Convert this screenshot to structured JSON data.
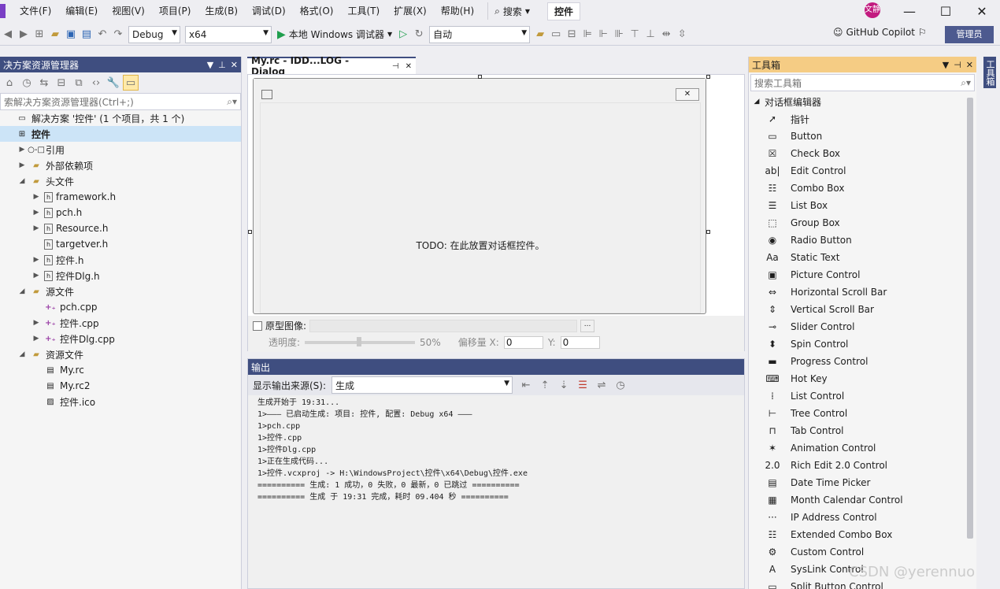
{
  "menu": {
    "items": [
      "文件(F)",
      "编辑(E)",
      "视图(V)",
      "项目(P)",
      "生成(B)",
      "调试(D)",
      "格式(O)",
      "工具(T)",
      "扩展(X)",
      "帮助(H)"
    ],
    "search_label": "搜索",
    "project_name": "控件",
    "user_initials": "文静"
  },
  "toolbar": {
    "configuration": "Debug",
    "platform": "x64",
    "run_label": "本地 Windows 调试器",
    "solution_config": "自动",
    "copilot_label": "GitHub Copilot",
    "admin_label": "管理员"
  },
  "solution_explorer": {
    "title": "决方案资源管理器",
    "search_placeholder": "索解决方案资源管理器(Ctrl+;)",
    "tree": [
      {
        "label": "解决方案 '控件' (1 个项目，共 1 个)",
        "icon": "solution-icon",
        "indent": 0,
        "twisty": ""
      },
      {
        "label": "控件",
        "icon": "project-icon",
        "indent": 0,
        "twisty": "",
        "selected": true,
        "bold": true
      },
      {
        "label": "引用",
        "icon": "references-icon",
        "indent": 1,
        "twisty": "▶"
      },
      {
        "label": "外部依赖项",
        "icon": "external-deps-icon",
        "indent": 1,
        "twisty": "▶"
      },
      {
        "label": "头文件",
        "icon": "folder-icon",
        "indent": 1,
        "twisty": "◢"
      },
      {
        "label": "framework.h",
        "icon": "header-file-icon",
        "indent": 2,
        "twisty": "▶"
      },
      {
        "label": "pch.h",
        "icon": "header-file-icon",
        "indent": 2,
        "twisty": "▶"
      },
      {
        "label": "Resource.h",
        "icon": "header-file-icon",
        "indent": 2,
        "twisty": "▶"
      },
      {
        "label": "targetver.h",
        "icon": "header-file-icon",
        "indent": 2,
        "twisty": ""
      },
      {
        "label": "控件.h",
        "icon": "header-file-icon",
        "indent": 2,
        "twisty": "▶"
      },
      {
        "label": "控件Dlg.h",
        "icon": "header-file-icon",
        "indent": 2,
        "twisty": "▶"
      },
      {
        "label": "源文件",
        "icon": "folder-icon",
        "indent": 1,
        "twisty": "◢"
      },
      {
        "label": "pch.cpp",
        "icon": "cpp-file-icon",
        "indent": 2,
        "twisty": ""
      },
      {
        "label": "控件.cpp",
        "icon": "cpp-file-icon",
        "indent": 2,
        "twisty": "▶"
      },
      {
        "label": "控件Dlg.cpp",
        "icon": "cpp-file-icon",
        "indent": 2,
        "twisty": "▶"
      },
      {
        "label": "资源文件",
        "icon": "folder-icon",
        "indent": 1,
        "twisty": "◢"
      },
      {
        "label": "My.rc",
        "icon": "resource-file-icon",
        "indent": 2,
        "twisty": ""
      },
      {
        "label": "My.rc2",
        "icon": "resource-file-icon",
        "indent": 2,
        "twisty": ""
      },
      {
        "label": "控件.ico",
        "icon": "image-file-icon",
        "indent": 2,
        "twisty": ""
      }
    ]
  },
  "editor": {
    "tab_title": "My.rc - IDD...LOG - Dialog",
    "todo_text": "TODO: 在此放置对话框控件。",
    "prototype_label": "原型图像:",
    "transparency_label": "透明度:",
    "transparency_value": "50%",
    "offset_label": "偏移量 X:",
    "offset_x": "0",
    "y_label": "Y:",
    "offset_y": "0"
  },
  "output": {
    "title": "输出",
    "source_label": "显示输出来源(S):",
    "source_value": "生成",
    "lines": [
      "生成开始于 19:31...",
      "1>——— 已启动生成: 项目: 控件, 配置: Debug x64 ———",
      "1>pch.cpp",
      "1>控件.cpp",
      "1>控件Dlg.cpp",
      "1>正在生成代码...",
      "1>控件.vcxproj -> H:\\WindowsProject\\控件\\x64\\Debug\\控件.exe",
      "========== 生成: 1 成功，0 失败，0 最新，0 已跳过 ==========",
      "========== 生成 于 19:31 完成，耗时 09.404 秒 =========="
    ]
  },
  "toolbox": {
    "title": "工具箱",
    "search_placeholder": "搜索工具箱",
    "group": "对话框编辑器",
    "items": [
      {
        "label": "指针",
        "icon": "pointer-icon",
        "glyph": "➚"
      },
      {
        "label": "Button",
        "icon": "button-icon",
        "glyph": "▭"
      },
      {
        "label": "Check Box",
        "icon": "checkbox-icon",
        "glyph": "☒"
      },
      {
        "label": "Edit Control",
        "icon": "edit-control-icon",
        "glyph": "ab|"
      },
      {
        "label": "Combo Box",
        "icon": "combo-box-icon",
        "glyph": "☷"
      },
      {
        "label": "List Box",
        "icon": "list-box-icon",
        "glyph": "☰"
      },
      {
        "label": "Group Box",
        "icon": "group-box-icon",
        "glyph": "⬚"
      },
      {
        "label": "Radio Button",
        "icon": "radio-button-icon",
        "glyph": "◉"
      },
      {
        "label": "Static Text",
        "icon": "static-text-icon",
        "glyph": "Aa"
      },
      {
        "label": "Picture Control",
        "icon": "picture-control-icon",
        "glyph": "▣"
      },
      {
        "label": "Horizontal Scroll Bar",
        "icon": "hscroll-icon",
        "glyph": "⇔"
      },
      {
        "label": "Vertical Scroll Bar",
        "icon": "vscroll-icon",
        "glyph": "⇕"
      },
      {
        "label": "Slider Control",
        "icon": "slider-icon",
        "glyph": "⊸"
      },
      {
        "label": "Spin Control",
        "icon": "spin-icon",
        "glyph": "⬍"
      },
      {
        "label": "Progress Control",
        "icon": "progress-icon",
        "glyph": "▬"
      },
      {
        "label": "Hot Key",
        "icon": "hot-key-icon",
        "glyph": "⌨"
      },
      {
        "label": "List Control",
        "icon": "list-control-icon",
        "glyph": "⁞"
      },
      {
        "label": "Tree Control",
        "icon": "tree-control-icon",
        "glyph": "⊢"
      },
      {
        "label": "Tab Control",
        "icon": "tab-control-icon",
        "glyph": "⊓"
      },
      {
        "label": "Animation Control",
        "icon": "animation-icon",
        "glyph": "✶"
      },
      {
        "label": "Rich Edit 2.0 Control",
        "icon": "rich-edit-icon",
        "glyph": "2.0"
      },
      {
        "label": "Date Time Picker",
        "icon": "date-time-icon",
        "glyph": "▤"
      },
      {
        "label": "Month Calendar Control",
        "icon": "calendar-icon",
        "glyph": "▦"
      },
      {
        "label": "IP Address Control",
        "icon": "ip-address-icon",
        "glyph": "···"
      },
      {
        "label": "Extended Combo Box",
        "icon": "extended-combo-icon",
        "glyph": "☷"
      },
      {
        "label": "Custom Control",
        "icon": "custom-control-icon",
        "glyph": "⚙"
      },
      {
        "label": "SysLink Control",
        "icon": "syslink-icon",
        "glyph": "A"
      },
      {
        "label": "Split Button Control",
        "icon": "split-button-icon",
        "glyph": "▭"
      }
    ],
    "side_tab_label": "工具箱"
  },
  "watermark": "CSDN @yerennuo",
  "colors": {
    "accent": "#3f4e80",
    "selection": "#cce4f7",
    "run_green": "#1f9e4d",
    "cpp_purple": "#9a3fa6"
  }
}
